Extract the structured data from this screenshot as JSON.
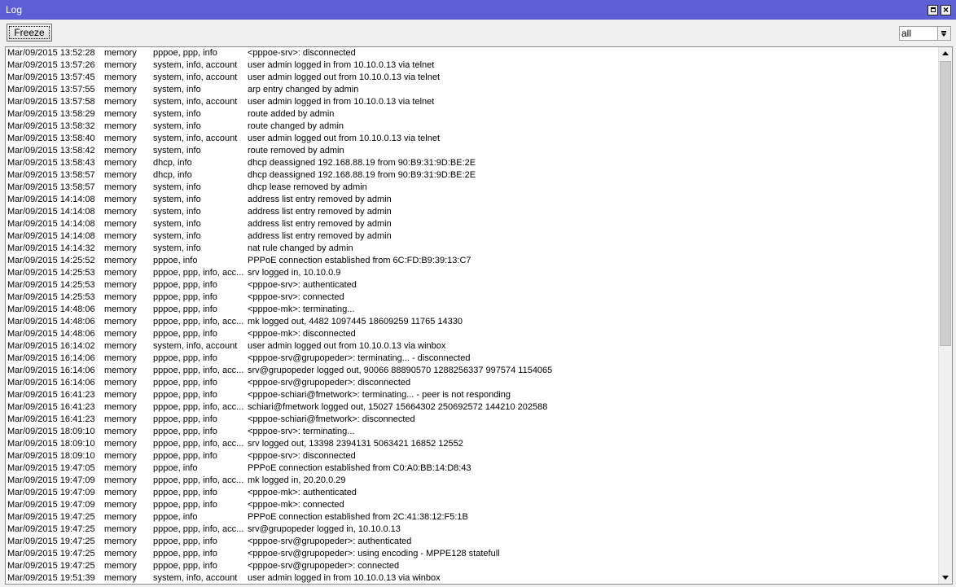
{
  "window": {
    "title": "Log"
  },
  "toolbar": {
    "freeze_label": "Freeze",
    "filter_value": "all"
  },
  "log": {
    "rows": [
      {
        "time": "Mar/09/2015 13:52:28",
        "buffer": "memory",
        "topics": "pppoe, ppp, info",
        "message": "<pppoe-srv>: disconnected"
      },
      {
        "time": "Mar/09/2015 13:57:26",
        "buffer": "memory",
        "topics": "system, info, account",
        "message": "user admin logged in from 10.10.0.13 via telnet"
      },
      {
        "time": "Mar/09/2015 13:57:45",
        "buffer": "memory",
        "topics": "system, info, account",
        "message": "user admin logged out from 10.10.0.13 via telnet"
      },
      {
        "time": "Mar/09/2015 13:57:55",
        "buffer": "memory",
        "topics": "system, info",
        "message": "arp entry changed by admin"
      },
      {
        "time": "Mar/09/2015 13:57:58",
        "buffer": "memory",
        "topics": "system, info, account",
        "message": "user admin logged in from 10.10.0.13 via telnet"
      },
      {
        "time": "Mar/09/2015 13:58:29",
        "buffer": "memory",
        "topics": "system, info",
        "message": "route added by admin"
      },
      {
        "time": "Mar/09/2015 13:58:32",
        "buffer": "memory",
        "topics": "system, info",
        "message": "route changed by admin"
      },
      {
        "time": "Mar/09/2015 13:58:40",
        "buffer": "memory",
        "topics": "system, info, account",
        "message": "user admin logged out from 10.10.0.13 via telnet"
      },
      {
        "time": "Mar/09/2015 13:58:42",
        "buffer": "memory",
        "topics": "system, info",
        "message": "route removed by admin"
      },
      {
        "time": "Mar/09/2015 13:58:43",
        "buffer": "memory",
        "topics": "dhcp, info",
        "message": "dhcp deassigned 192.168.88.19 from 90:B9:31:9D:BE:2E"
      },
      {
        "time": "Mar/09/2015 13:58:57",
        "buffer": "memory",
        "topics": "dhcp, info",
        "message": "dhcp deassigned 192.168.88.19 from 90:B9:31:9D:BE:2E"
      },
      {
        "time": "Mar/09/2015 13:58:57",
        "buffer": "memory",
        "topics": "system, info",
        "message": "dhcp lease removed by admin"
      },
      {
        "time": "Mar/09/2015 14:14:08",
        "buffer": "memory",
        "topics": "system, info",
        "message": "address list entry removed by admin"
      },
      {
        "time": "Mar/09/2015 14:14:08",
        "buffer": "memory",
        "topics": "system, info",
        "message": "address list entry removed by admin"
      },
      {
        "time": "Mar/09/2015 14:14:08",
        "buffer": "memory",
        "topics": "system, info",
        "message": "address list entry removed by admin"
      },
      {
        "time": "Mar/09/2015 14:14:08",
        "buffer": "memory",
        "topics": "system, info",
        "message": "address list entry removed by admin"
      },
      {
        "time": "Mar/09/2015 14:14:32",
        "buffer": "memory",
        "topics": "system, info",
        "message": "nat rule changed by admin"
      },
      {
        "time": "Mar/09/2015 14:25:52",
        "buffer": "memory",
        "topics": "pppoe, info",
        "message": "PPPoE connection established from 6C:FD:B9:39:13:C7"
      },
      {
        "time": "Mar/09/2015 14:25:53",
        "buffer": "memory",
        "topics": "pppoe, ppp, info, acc...",
        "message": "srv logged in, 10.10.0.9"
      },
      {
        "time": "Mar/09/2015 14:25:53",
        "buffer": "memory",
        "topics": "pppoe, ppp, info",
        "message": "<pppoe-srv>: authenticated"
      },
      {
        "time": "Mar/09/2015 14:25:53",
        "buffer": "memory",
        "topics": "pppoe, ppp, info",
        "message": "<pppoe-srv>: connected"
      },
      {
        "time": "Mar/09/2015 14:48:06",
        "buffer": "memory",
        "topics": "pppoe, ppp, info",
        "message": "<pppoe-mk>: terminating..."
      },
      {
        "time": "Mar/09/2015 14:48:06",
        "buffer": "memory",
        "topics": "pppoe, ppp, info, acc...",
        "message": "mk logged out, 4482 1097445 18609259 11765 14330"
      },
      {
        "time": "Mar/09/2015 14:48:06",
        "buffer": "memory",
        "topics": "pppoe, ppp, info",
        "message": "<pppoe-mk>: disconnected"
      },
      {
        "time": "Mar/09/2015 16:14:02",
        "buffer": "memory",
        "topics": "system, info, account",
        "message": "user admin logged out from 10.10.0.13 via winbox"
      },
      {
        "time": "Mar/09/2015 16:14:06",
        "buffer": "memory",
        "topics": "pppoe, ppp, info",
        "message": "<pppoe-srv@grupopeder>: terminating... - disconnected"
      },
      {
        "time": "Mar/09/2015 16:14:06",
        "buffer": "memory",
        "topics": "pppoe, ppp, info, acc...",
        "message": "srv@grupopeder logged out, 90066 88890570 1288256337 997574 1154065"
      },
      {
        "time": "Mar/09/2015 16:14:06",
        "buffer": "memory",
        "topics": "pppoe, ppp, info",
        "message": "<pppoe-srv@grupopeder>: disconnected"
      },
      {
        "time": "Mar/09/2015 16:41:23",
        "buffer": "memory",
        "topics": "pppoe, ppp, info",
        "message": "<pppoe-schiari@fmetwork>: terminating... - peer is not responding"
      },
      {
        "time": "Mar/09/2015 16:41:23",
        "buffer": "memory",
        "topics": "pppoe, ppp, info, acc...",
        "message": "schiari@fmetwork logged out, 15027 15664302 250692572 144210 202588"
      },
      {
        "time": "Mar/09/2015 16:41:23",
        "buffer": "memory",
        "topics": "pppoe, ppp, info",
        "message": "<pppoe-schiari@fmetwork>: disconnected"
      },
      {
        "time": "Mar/09/2015 18:09:10",
        "buffer": "memory",
        "topics": "pppoe, ppp, info",
        "message": "<pppoe-srv>: terminating..."
      },
      {
        "time": "Mar/09/2015 18:09:10",
        "buffer": "memory",
        "topics": "pppoe, ppp, info, acc...",
        "message": "srv logged out, 13398 2394131 5063421 16852 12552"
      },
      {
        "time": "Mar/09/2015 18:09:10",
        "buffer": "memory",
        "topics": "pppoe, ppp, info",
        "message": "<pppoe-srv>: disconnected"
      },
      {
        "time": "Mar/09/2015 19:47:05",
        "buffer": "memory",
        "topics": "pppoe, info",
        "message": "PPPoE connection established from C0:A0:BB:14:D8:43"
      },
      {
        "time": "Mar/09/2015 19:47:09",
        "buffer": "memory",
        "topics": "pppoe, ppp, info, acc...",
        "message": "mk logged in, 20.20.0.29"
      },
      {
        "time": "Mar/09/2015 19:47:09",
        "buffer": "memory",
        "topics": "pppoe, ppp, info",
        "message": "<pppoe-mk>: authenticated"
      },
      {
        "time": "Mar/09/2015 19:47:09",
        "buffer": "memory",
        "topics": "pppoe, ppp, info",
        "message": "<pppoe-mk>: connected"
      },
      {
        "time": "Mar/09/2015 19:47:25",
        "buffer": "memory",
        "topics": "pppoe, info",
        "message": "PPPoE connection established from 2C:41:38:12:F5:1B"
      },
      {
        "time": "Mar/09/2015 19:47:25",
        "buffer": "memory",
        "topics": "pppoe, ppp, info, acc...",
        "message": "srv@grupopeder logged in, 10.10.0.13"
      },
      {
        "time": "Mar/09/2015 19:47:25",
        "buffer": "memory",
        "topics": "pppoe, ppp, info",
        "message": "<pppoe-srv@grupopeder>: authenticated"
      },
      {
        "time": "Mar/09/2015 19:47:25",
        "buffer": "memory",
        "topics": "pppoe, ppp, info",
        "message": "<pppoe-srv@grupopeder>: using encoding - MPPE128 statefull"
      },
      {
        "time": "Mar/09/2015 19:47:25",
        "buffer": "memory",
        "topics": "pppoe, ppp, info",
        "message": "<pppoe-srv@grupopeder>: connected"
      },
      {
        "time": "Mar/09/2015 19:51:39",
        "buffer": "memory",
        "topics": "system, info, account",
        "message": "user admin logged in from 10.10.0.13 via winbox"
      }
    ]
  }
}
